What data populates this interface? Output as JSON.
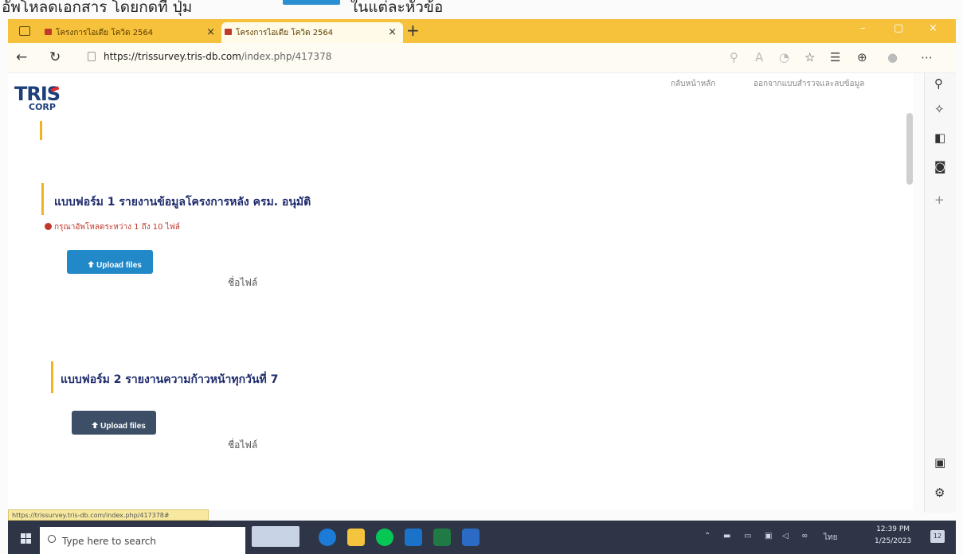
{
  "caption": {
    "pre": "อัพโหลดเอกสาร โดยกดที่ ปุ่ม",
    "post": "ในแต่ละหัวข้อ"
  },
  "browser": {
    "tabs": [
      {
        "title": "โครงการไอเดีย โควิด 2564",
        "close": "×"
      },
      {
        "title": "โครงการไอเดีย โควิด 2564",
        "close": "×"
      }
    ],
    "new_tab": "+",
    "window_controls": {
      "minimize": "–",
      "maximize": "▢",
      "close": "×"
    },
    "url_host": "https://trissurvey.tris-db.com",
    "url_path": "/index.php/417378",
    "status_url": "https://trissurvey.tris-db.com/index.php/417378#"
  },
  "site": {
    "logo_text": "TRIS",
    "logo_sub": "CORP",
    "nav": [
      "กลับหน้าหลัก",
      "ออกจากแบบสำรวจและลบข้อมูล"
    ]
  },
  "sections": [
    {
      "title": "แบบฟอร์ม 1 รายงานข้อมูลโครงการหลัง ครม. อนุมัติ",
      "notice": "กรุณาอัพโหลดระหว่าง 1 ถึง 10 ไฟล์",
      "button_label": "Upload files",
      "filename_label": "ชื่อไฟล์"
    },
    {
      "title": "แบบฟอร์ม 2 รายงานความก้าวหน้าทุกวันที่ 7",
      "button_label": "Upload files",
      "filename_label": "ชื่อไฟล์"
    }
  ],
  "taskbar": {
    "search_placeholder": "Type here to search",
    "language": "ไทย",
    "time": "12:39 PM",
    "date": "1/25/2023",
    "notifications": "12"
  },
  "colors": {
    "tab_bar": "#f6c13b",
    "upload_blue": "#2289c8",
    "upload_dark": "#3d4f66",
    "title_navy": "#1e2b6d",
    "notice_red": "#c0392b",
    "accent_yellow": "#f2b320"
  }
}
